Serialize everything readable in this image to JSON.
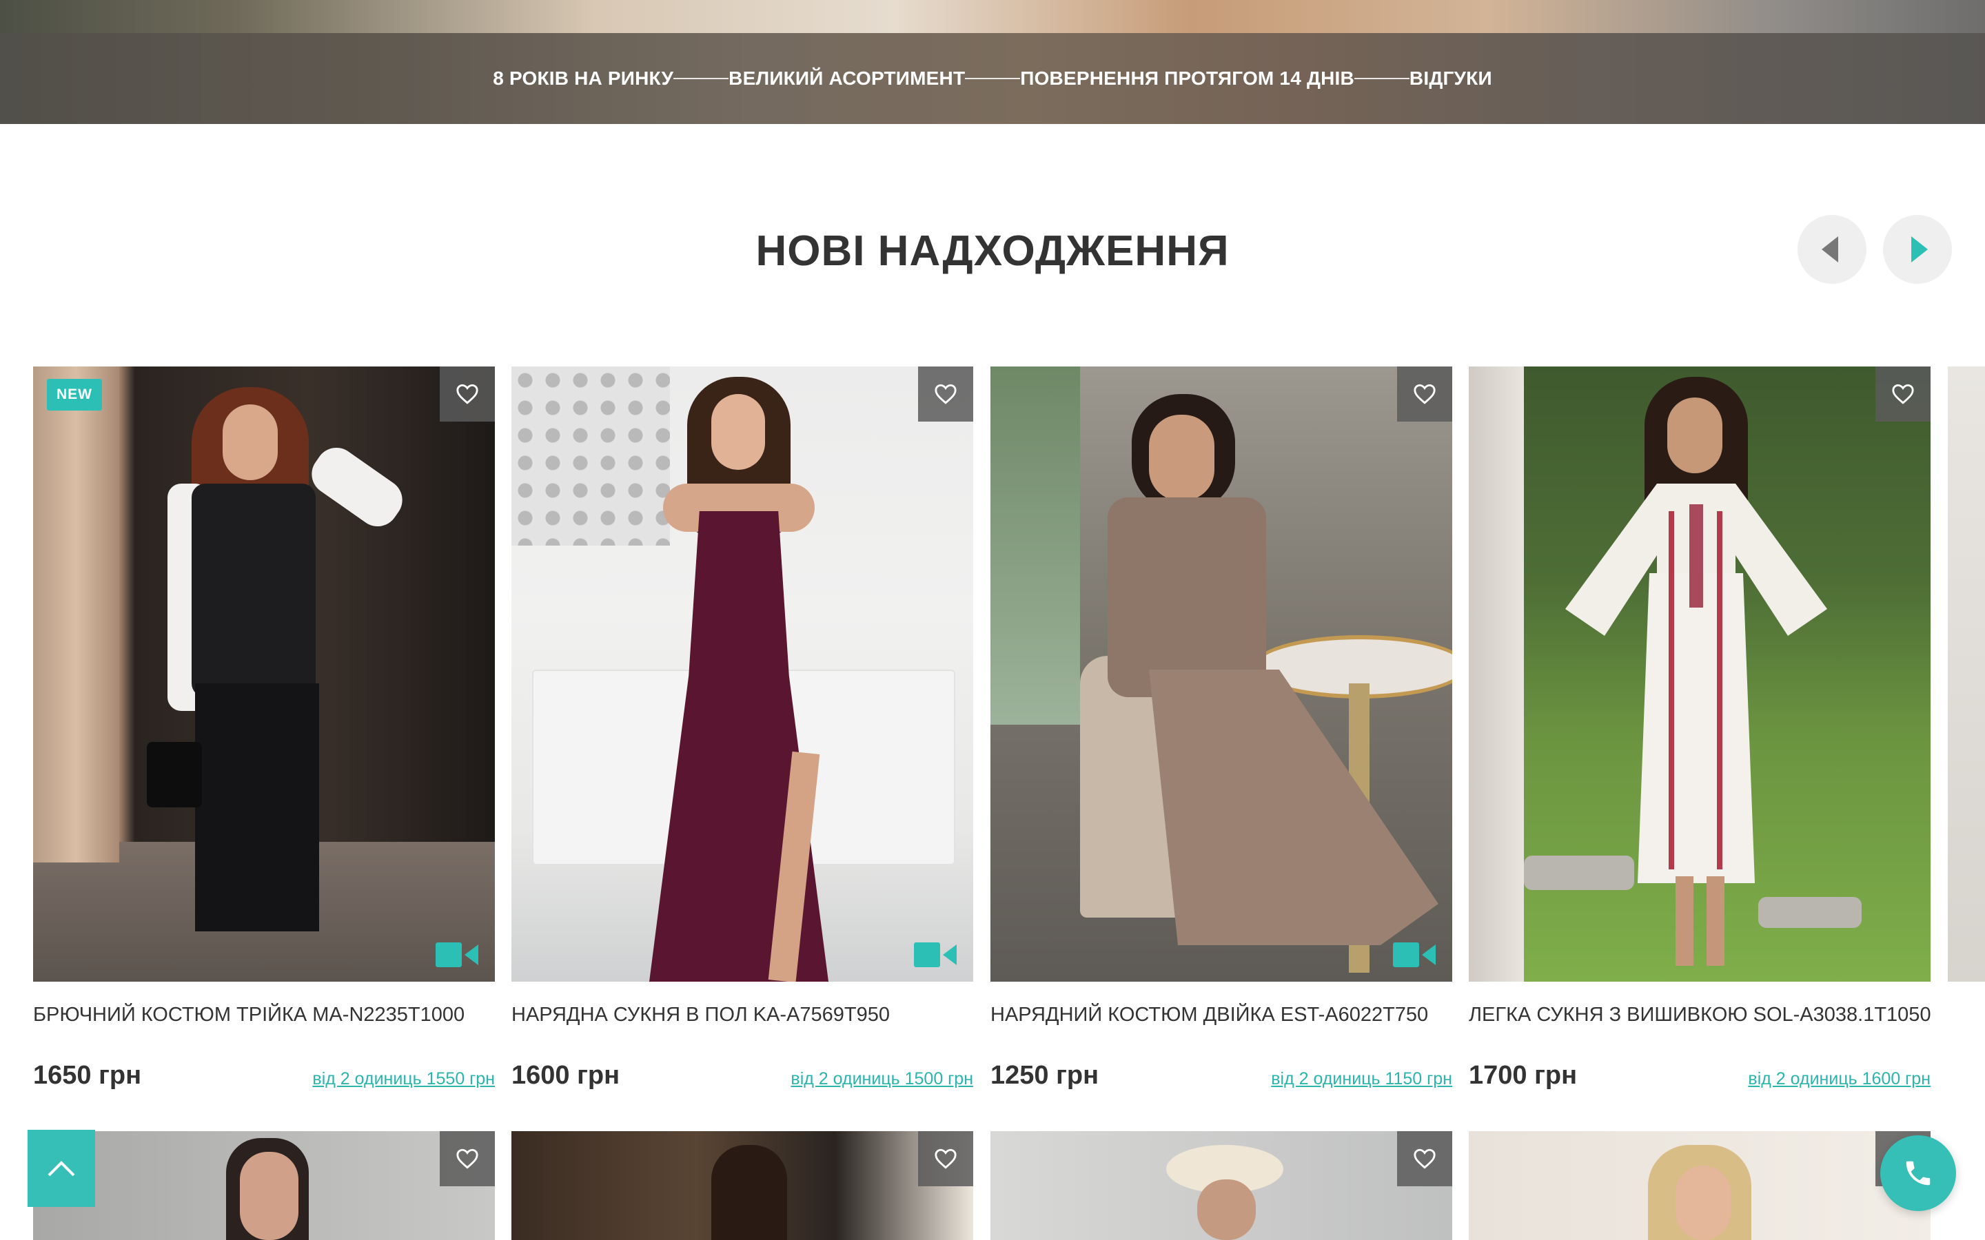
{
  "advantages": [
    "8 РОКІВ НА РИНКУ",
    "ВЕЛИКИЙ АСОРТИМЕНТ",
    "ПОВЕРНЕННЯ ПРОТЯГОМ 14 ДНІВ",
    "ВІДГУКИ"
  ],
  "section": {
    "title": "НОВІ НАДХОДЖЕННЯ"
  },
  "products": [
    {
      "badge": "NEW",
      "title": "БРЮЧНИЙ КОСТЮМ ТРІЙКА MA-N2235T1000",
      "price": "1650 грн",
      "bulk_price": "від 2 одиниць 1550 грн",
      "has_video": true
    },
    {
      "title": "НАРЯДНА СУКНЯ В ПОЛ KA-A7569T950",
      "price": "1600 грн",
      "bulk_price": "від 2 одиниць 1500 грн",
      "has_video": true
    },
    {
      "title": "НАРЯДНИЙ КОСТЮМ ДВІЙКА EST-A6022T750",
      "price": "1250 грн",
      "bulk_price": "від 2 одиниць 1150 грн",
      "has_video": true
    },
    {
      "title": "ЛЕГКА СУКНЯ З ВИШИВКОЮ SOL-A3038.1T1050",
      "price": "1700 грн",
      "bulk_price": "від 2 одиниць 1600 грн",
      "has_video": false
    }
  ],
  "colors": {
    "accent": "#2bbfb5",
    "text": "#333333",
    "wish_bg": "#5a5a5a"
  },
  "icons": {
    "wishlist": "heart-icon",
    "video": "video-camera-icon",
    "prev": "triangle-left-icon",
    "next": "triangle-right-icon",
    "scroll_top": "chevron-up-icon",
    "call": "phone-icon"
  }
}
